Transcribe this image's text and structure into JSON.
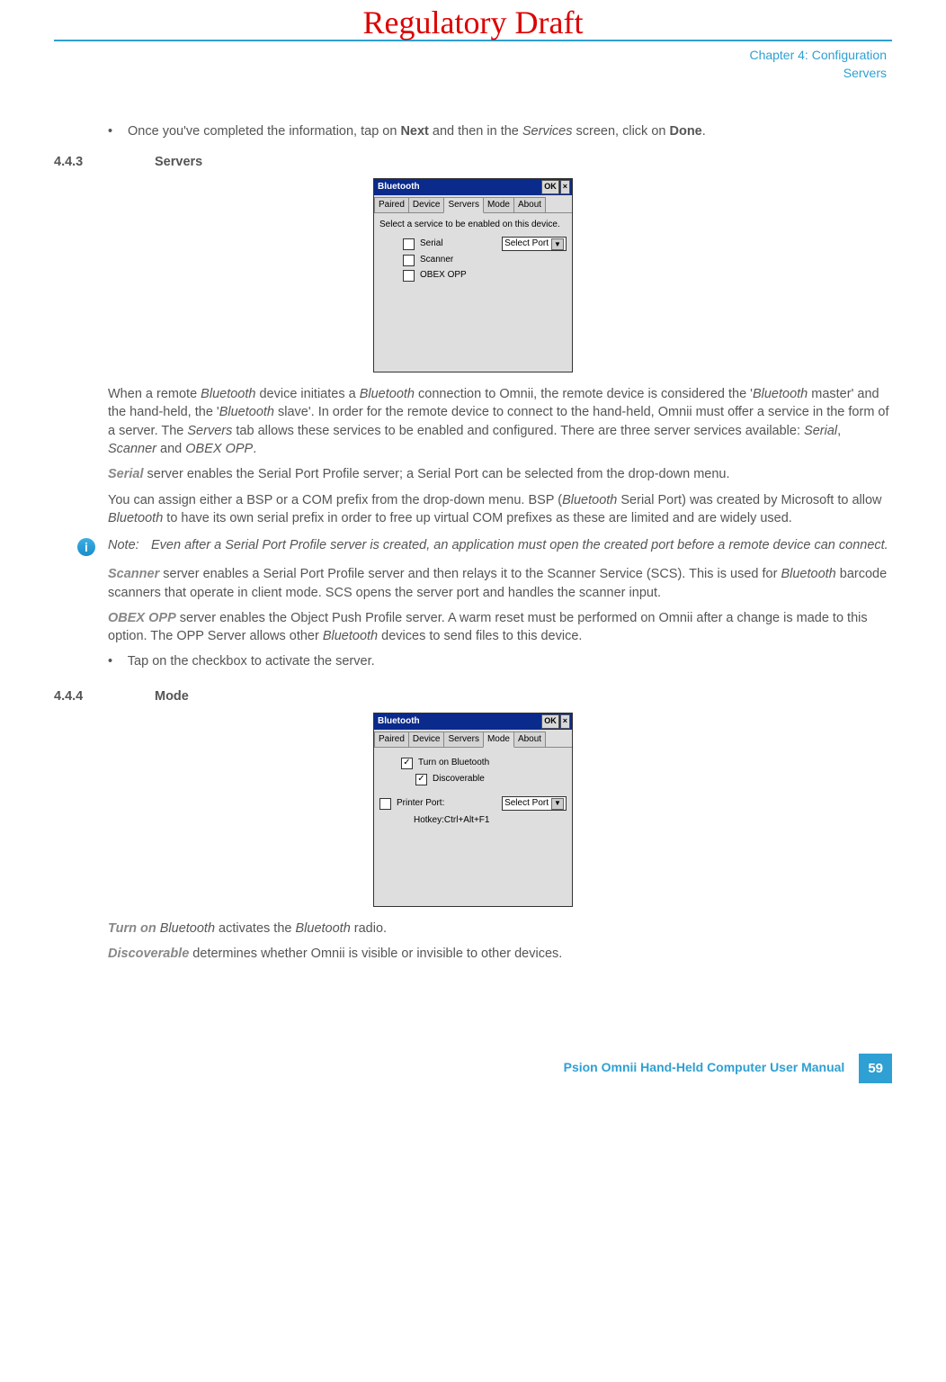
{
  "watermark": "Regulatory Draft",
  "header": {
    "chapter": "Chapter 4:  Configuration",
    "section": "Servers"
  },
  "intro_bullet": {
    "pre": "Once you've completed the information, tap on ",
    "b1": "Next",
    "mid": " and then in the ",
    "i1": "Services",
    "post": " screen, click on ",
    "b2": "Done",
    "end": "."
  },
  "sec_443": {
    "num": "4.4.3",
    "title": "Servers"
  },
  "shot1": {
    "title": "Bluetooth",
    "ok": "OK",
    "x": "×",
    "tabs": {
      "paired": "Paired",
      "device": "Device",
      "servers": "Servers",
      "mode": "Mode",
      "about": "About"
    },
    "instr": "Select a service to be enabled on this device.",
    "serial": "Serial",
    "scanner": "Scanner",
    "obex": "OBEX OPP",
    "select_port": "Select Port"
  },
  "p1": {
    "t0": "When a remote ",
    "i0": "Bluetooth",
    "t1": " device initiates a ",
    "i1": "Bluetooth",
    "t2": " connection to Omnii, the remote device is considered the '",
    "i2": "Bluetooth",
    "t3": " master' and the hand-held, the '",
    "i3": "Bluetooth ",
    "t4": " slave'. In order for the remote device to connect to the hand-held, Omnii must offer a service in the form of a server. The ",
    "i4": "Servers",
    "t5": " tab allows these services to be enabled and configured. There are three server services available: ",
    "i5": "Serial",
    "t6": ", ",
    "i6": "Scanner",
    "t7": " and ",
    "i7": "OBEX OPP",
    "t8": "."
  },
  "p2": {
    "b0": "Serial",
    "t0": " server enables the Serial Port Profile server; a Serial Port can be selected from the drop-down menu."
  },
  "p3": {
    "t0": "You can assign either a BSP or a COM prefix from the drop-down menu. BSP (",
    "i0": "Bluetooth",
    "t1": " Serial Port) was created by Microsoft to allow ",
    "i1": "Bluetooth",
    "t2": " to have its own serial prefix in order to free up virtual COM prefixes as these are limited and are widely used."
  },
  "note1": {
    "label": "Note:",
    "text": "Even after a Serial Port Profile server is created, an application must open the created port before a remote device can connect."
  },
  "p4": {
    "b0": "Scanner",
    "t0": " server enables a Serial Port Profile server and then relays it to the Scanner Service (SCS). This is used for ",
    "i0": "Bluetooth",
    "t1": " barcode scanners that operate in client mode. SCS opens the server port and handles the scanner input."
  },
  "p5": {
    "b0": "OBEX OPP",
    "t0": " server enables the Object Push Profile server. A warm reset must be performed on Omnii after a change is made to this option. The OPP Server allows other ",
    "i0": "Bluetooth",
    "t1": " devices to send files to this device."
  },
  "bullet2": "Tap on the checkbox to activate the server.",
  "sec_444": {
    "num": "4.4.4",
    "title": "Mode"
  },
  "shot2": {
    "title": "Bluetooth",
    "ok": "OK",
    "x": "×",
    "tabs": {
      "paired": "Paired",
      "device": "Device",
      "servers": "Servers",
      "mode": "Mode",
      "about": "About"
    },
    "turn_on": "Turn on Bluetooth",
    "discoverable": "Discoverable",
    "printer": "Printer Port:",
    "select_port": "Select Port",
    "hotkey": "Hotkey:Ctrl+Alt+F1"
  },
  "p6": {
    "b0": "Turn on",
    "i0": " Bluetooth",
    "t0": " activates the ",
    "i1": "Bluetooth",
    "t1": " radio."
  },
  "p7": {
    "b0": "Discoverable",
    "t0": " determines whether Omnii is visible or invisible to other devices."
  },
  "footer": {
    "title": "Psion Omnii Hand-Held Computer User Manual",
    "page": "59"
  }
}
